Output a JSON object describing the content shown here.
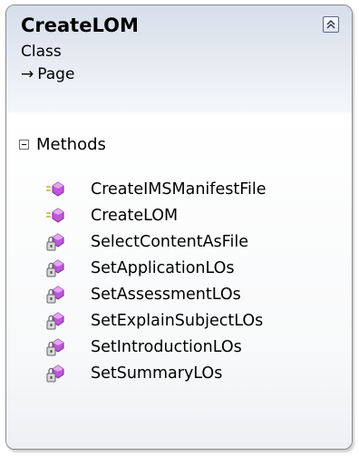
{
  "class": {
    "name": "CreateLOM",
    "stereotype": "Class",
    "base": "Page"
  },
  "compartment": {
    "label": "Methods"
  },
  "methods": [
    {
      "name": "CreateIMSManifestFile",
      "visibility": "public"
    },
    {
      "name": "CreateLOM",
      "visibility": "public"
    },
    {
      "name": "SelectContentAsFile",
      "visibility": "private"
    },
    {
      "name": "SetApplicationLOs",
      "visibility": "private"
    },
    {
      "name": "SetAssessmentLOs",
      "visibility": "private"
    },
    {
      "name": "SetExplainSubjectLOs",
      "visibility": "private"
    },
    {
      "name": "SetIntroductionLOs",
      "visibility": "private"
    },
    {
      "name": "SetSummaryLOs",
      "visibility": "private"
    }
  ],
  "colors": {
    "method_icon": "#b44bd9",
    "header_gradient_top": "#d6deea"
  }
}
